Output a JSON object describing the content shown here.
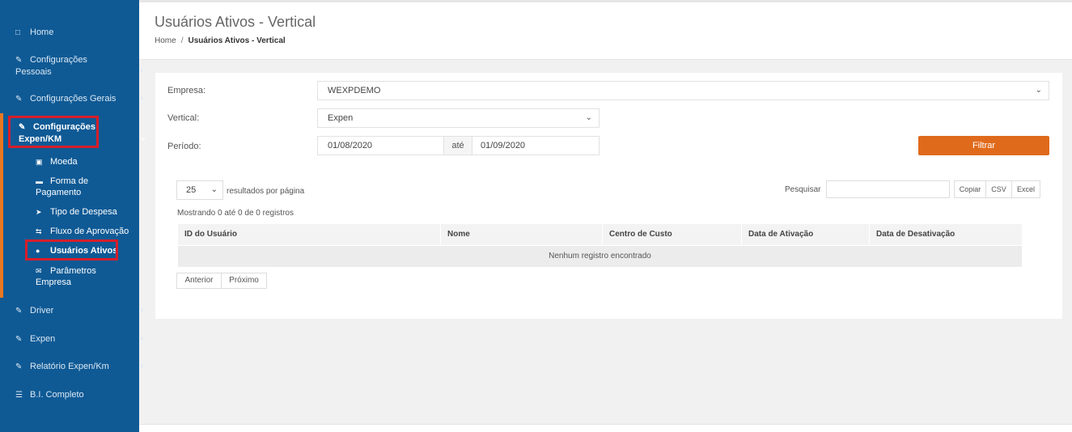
{
  "sidebar": {
    "items": [
      {
        "label": "Home",
        "icon": "laptop-icon"
      },
      {
        "label1": "Configurações",
        "label2": "Pessoais",
        "icon": "edit-icon"
      },
      {
        "label": "Configurações Gerais",
        "icon": "edit-icon"
      },
      {
        "label1": "Configurações",
        "label2": "Expen/KM",
        "icon": "edit-icon"
      },
      {
        "label": "Driver",
        "icon": "edit-icon"
      },
      {
        "label": "Expen",
        "icon": "edit-icon"
      },
      {
        "label": "Relatório Expen/Km",
        "icon": "edit-icon"
      },
      {
        "label": "B.I. Completo",
        "icon": "list-icon"
      }
    ],
    "sub_items": [
      {
        "label": "Moeda",
        "icon": "money-icon"
      },
      {
        "label1": "Forma de",
        "label2": "Pagamento",
        "icon": "card-icon"
      },
      {
        "label": "Tipo de Despesa",
        "icon": "tag-icon"
      },
      {
        "label": "Fluxo de Aprovação",
        "icon": "retweet-icon"
      },
      {
        "label": "Usuários Ativos",
        "icon": "user-icon"
      },
      {
        "label1": "Parâmetros",
        "label2": "Empresa",
        "icon": "envelope-icon"
      }
    ],
    "accent_color": "#e87722",
    "highlight_color": "#d61e2a"
  },
  "header": {
    "title": "Usuários Ativos - Vertical",
    "breadcrumb": {
      "home": "Home",
      "sep": "/",
      "current": "Usuários Ativos - Vertical"
    }
  },
  "filters": {
    "empresa_label": "Empresa:",
    "empresa_value": "WEXPDEMO",
    "vertical_label": "Vertical:",
    "vertical_value": "Expen",
    "periodo_label": "Período:",
    "date_from": "01/08/2020",
    "ate": "até",
    "date_to": "01/09/2020",
    "filter_button": "Filtrar"
  },
  "table": {
    "per_page_value": "25",
    "per_page_label": "resultados por página",
    "search_label": "Pesquisar",
    "export_buttons": [
      "Copiar",
      "CSV",
      "Excel"
    ],
    "showing": "Mostrando 0 até 0 de 0 registros",
    "columns": [
      "ID do Usuário",
      "Nome",
      "Centro de Custo",
      "Data de Ativação",
      "Data de Desativação"
    ],
    "empty_message": "Nenhum registro encontrado",
    "prev": "Anterior",
    "next": "Próximo"
  }
}
